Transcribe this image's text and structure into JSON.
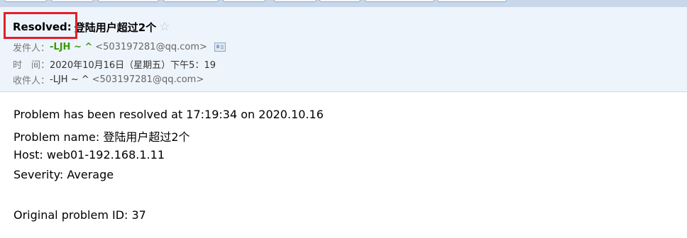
{
  "subject": {
    "prefix": "Resolved:",
    "title": "登陆用户超过2个",
    "star": "☆"
  },
  "from": {
    "label": "发件人：",
    "name": "-LJH ~ ^",
    "address": "<503197281@qq.com>"
  },
  "time": {
    "label": "时　间：",
    "value": "2020年10月16日（星期五）下午5：19"
  },
  "to": {
    "label": "收件人：",
    "name": "-LJH ~ ^",
    "address": "<503197281@qq.com>"
  },
  "body": {
    "line1": "Problem has been resolved at 17:19:34 on 2020.10.16",
    "line2": "Problem name: 登陆用户超过2个",
    "line3": "Host: web01-192.168.1.11",
    "line4": "Severity: Average",
    "line5": "Original problem ID: 37"
  },
  "colors": {
    "highlight": "#e0202a",
    "sender": "#3a9a0a",
    "header_bg": "#eef4fb"
  }
}
